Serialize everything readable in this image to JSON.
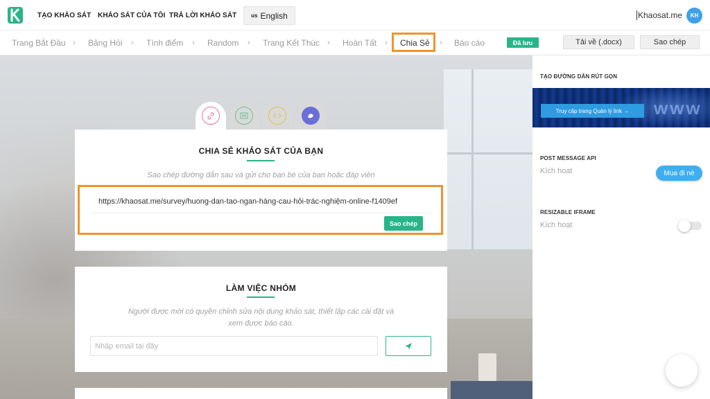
{
  "nav": {
    "links": [
      "TẠO KHẢO SÁT",
      "KHẢO SÁT CỦA TÔI",
      "TRẢ LỜI KHẢO SÁT"
    ],
    "language": {
      "flag": "us",
      "label": "English"
    },
    "user_name": "Khaosat.me",
    "avatar_initials": "KH"
  },
  "steps": {
    "items": [
      "Trang Bắt Đầu",
      "Bảng Hỏi",
      "Tính điểm",
      "Random",
      "Trang Kết Thúc",
      "Hoàn Tất",
      "Chia Sẻ",
      "Báo cáo"
    ],
    "active": "Chia Sẻ",
    "saved_badge": "Đã lưu",
    "download_label": "Tải về (.docx)",
    "copy_label": "Sao chép"
  },
  "share_card": {
    "title": "CHIA SẺ KHẢO SÁT CỦA BẠN",
    "description": "Sao chép đường dẫn sau và gửi cho bạn bè của bạn hoặc đáp viên",
    "url": "https://khaosat.me/survey/huong-dan-tao-ngan-hàng-cau-hỏi-trác-nghiệm-online-f1409ef",
    "copy_button": "Sao chép"
  },
  "team_card": {
    "title": "LÀM VIỆC NHÓM",
    "description_line1": "Người được mời có quyền chỉnh sửa nội dung khảo sát, thiết lập các cài đặt và",
    "description_line2": "xem được báo cáo.",
    "email_placeholder": "Nhập email tại đây"
  },
  "right_panel": {
    "short_link_heading": "TẠO ĐƯỜNG DẪN RÚT GỌN",
    "banner_text": "www",
    "manage_link_button": "Truy cập trang Quản lý link →",
    "post_message_heading": "POST MESSAGE API",
    "post_message_status": "Kích hoạt",
    "buy_button": "Mua đi nè",
    "resizable_heading": "RESIZABLE IFRAME",
    "resizable_status": "Kích hoạt"
  },
  "colors": {
    "accent_green": "#2ab48a",
    "highlight_orange": "#f0932b",
    "blue": "#3eaef0"
  },
  "icons": [
    "link-icon",
    "embed-icon",
    "code-icon",
    "social-icon",
    "send-icon",
    "chevron-right-icon"
  ]
}
